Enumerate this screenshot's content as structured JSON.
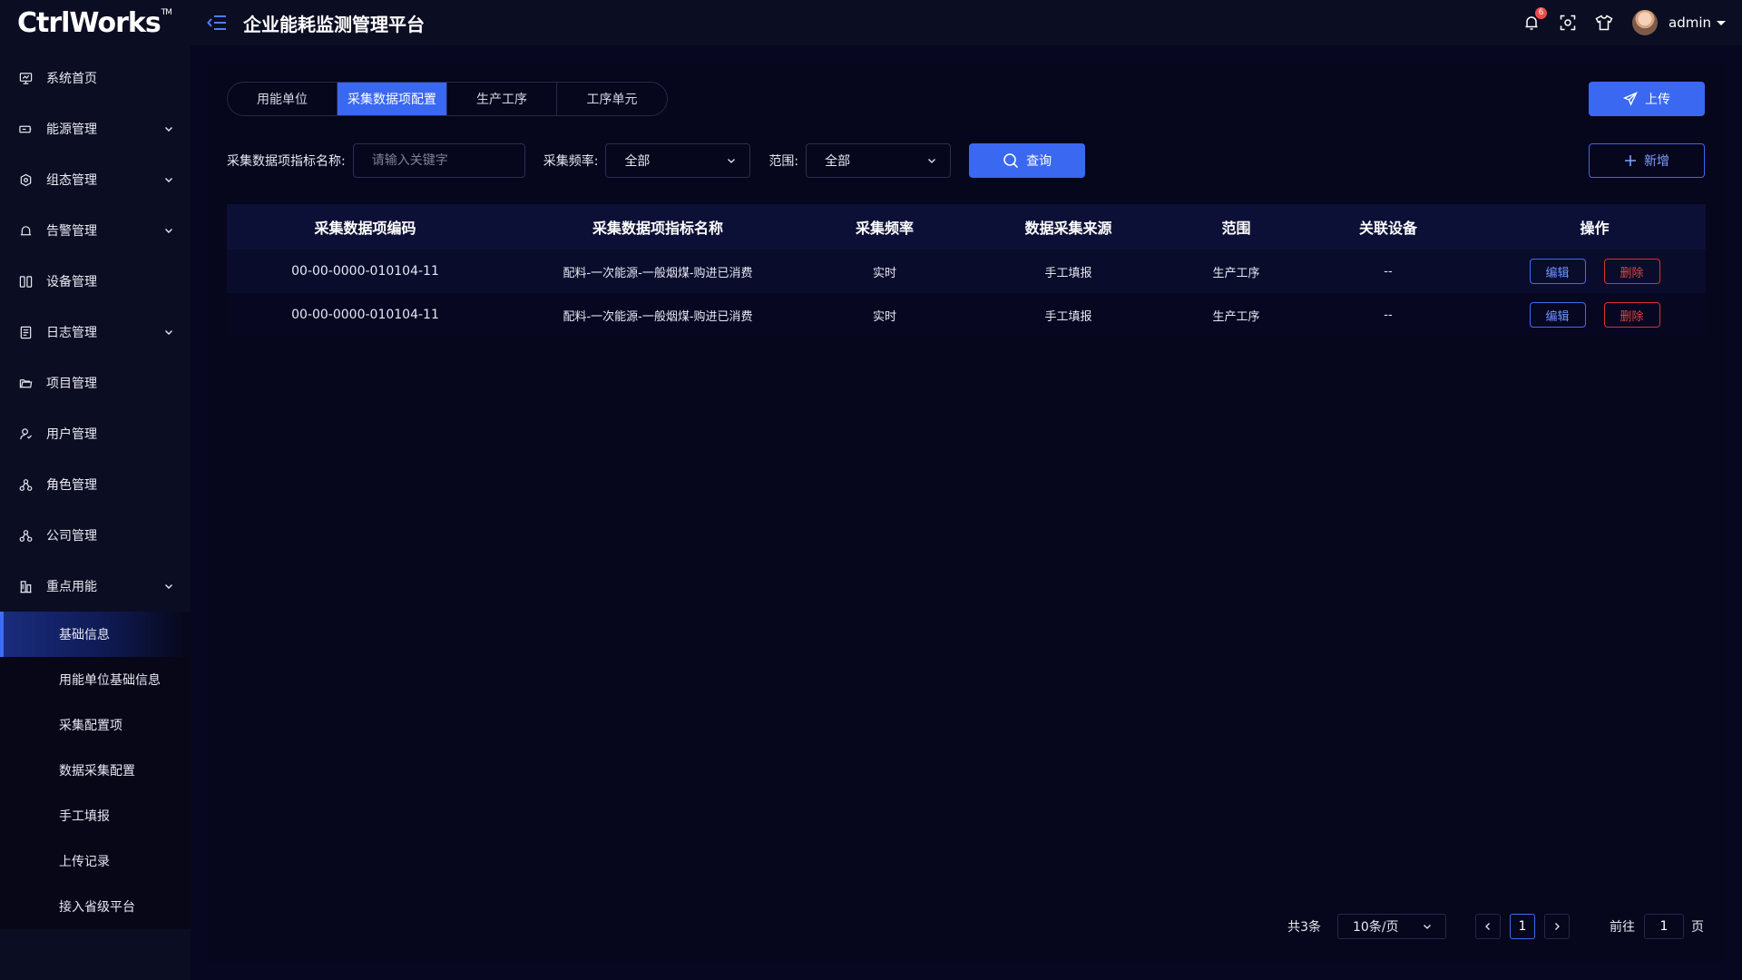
{
  "brand": {
    "logo": "CtrlWorks",
    "tm": "TM"
  },
  "header": {
    "title": "企业能耗监测管理平台",
    "notification_count": "6",
    "user_name": "admin"
  },
  "sidebar": {
    "items": [
      {
        "label": "系统首页",
        "icon": "monitor-icon",
        "expandable": false
      },
      {
        "label": "能源管理",
        "icon": "battery-icon",
        "expandable": true
      },
      {
        "label": "组态管理",
        "icon": "cube-icon",
        "expandable": true
      },
      {
        "label": "告警管理",
        "icon": "bell-icon",
        "expandable": true
      },
      {
        "label": "设备管理",
        "icon": "device-icon",
        "expandable": false
      },
      {
        "label": "日志管理",
        "icon": "log-icon",
        "expandable": true
      },
      {
        "label": "项目管理",
        "icon": "folder-icon",
        "expandable": false
      },
      {
        "label": "用户管理",
        "icon": "user-icon",
        "expandable": false
      },
      {
        "label": "角色管理",
        "icon": "role-icon",
        "expandable": false
      },
      {
        "label": "公司管理",
        "icon": "company-icon",
        "expandable": false
      },
      {
        "label": "重点用能",
        "icon": "building-icon",
        "expandable": true
      }
    ],
    "subitems": [
      "基础信息",
      "用能单位基础信息",
      "采集配置项",
      "数据采集配置",
      "手工填报",
      "上传记录",
      "接入省级平台"
    ],
    "active_subitem": 0
  },
  "tabs": [
    "用能单位",
    "采集数据项配置",
    "生产工序",
    "工序单元"
  ],
  "active_tab": 1,
  "buttons": {
    "upload": "上传",
    "query": "查询",
    "add": "新增",
    "edit": "编辑",
    "delete": "删除"
  },
  "filters": {
    "name_label": "采集数据项指标名称:",
    "name_placeholder": "请输入关键字",
    "name_value": "",
    "freq_label": "采集频率:",
    "freq_value": "全部",
    "scope_label": "范围:",
    "scope_value": "全部"
  },
  "table": {
    "columns": [
      "采集数据项编码",
      "采集数据项指标名称",
      "采集频率",
      "数据采集来源",
      "范围",
      "关联设备",
      "操作"
    ],
    "rows": [
      [
        "00-00-0000-010104-11",
        "配料-一次能源-一般烟煤-购进已消费",
        "实时",
        "手工填报",
        "生产工序",
        "--"
      ],
      [
        "00-00-0000-010104-11",
        "配料-一次能源-一般烟煤-购进已消费",
        "实时",
        "手工填报",
        "生产工序",
        "--"
      ]
    ]
  },
  "pagination": {
    "total": "共3条",
    "page_size": "10条/页",
    "current_page": "1",
    "goto_label": "前往",
    "goto_value": "1",
    "page_unit": "页"
  },
  "colors": {
    "accent": "#3a68f0",
    "danger": "#d83131",
    "background": "#070722",
    "sidebar": "#0b0d22"
  }
}
